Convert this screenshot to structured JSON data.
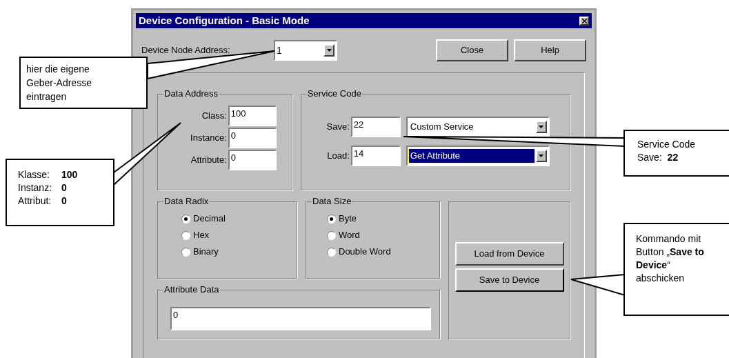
{
  "window": {
    "title": "Device Configuration - Basic Mode"
  },
  "node_address": {
    "label": "Device Node Address:",
    "value": "1"
  },
  "header_buttons": [
    {
      "label": "Close"
    },
    {
      "label": "Help"
    }
  ],
  "data_address": {
    "title": "Data Address",
    "fields": [
      {
        "label": "Class:",
        "value": "100"
      },
      {
        "label": "Instance:",
        "value": "0"
      },
      {
        "label": "Attribute:",
        "value": "0"
      }
    ]
  },
  "service_code": {
    "title": "Service Code",
    "rows": [
      {
        "label": "Save:",
        "value": "22",
        "service": "Custom Service",
        "focused": false
      },
      {
        "label": "Load:",
        "value": "14",
        "service": "Get Attribute",
        "focused": true
      }
    ]
  },
  "data_radix": {
    "title": "Data Radix",
    "options": [
      {
        "label": "Decimal",
        "selected": true
      },
      {
        "label": "Hex",
        "selected": false
      },
      {
        "label": "Binary",
        "selected": false
      }
    ]
  },
  "data_size": {
    "title": "Data Size",
    "options": [
      {
        "label": "Byte",
        "selected": true
      },
      {
        "label": "Word",
        "selected": false
      },
      {
        "label": "Double Word",
        "selected": false
      }
    ]
  },
  "device_buttons": [
    {
      "label": "Load from Device"
    },
    {
      "label": "Save to Device"
    }
  ],
  "attribute_data": {
    "title": "Attribute Data",
    "value": "0"
  },
  "callouts": {
    "node": "hier die eigene Geber-Adresse eintragen",
    "address": [
      {
        "label": "Klasse:",
        "value": "100"
      },
      {
        "label": "Instanz:",
        "value": "0"
      },
      {
        "label": "Attribut:",
        "value": "0"
      }
    ],
    "service": [
      "Service Code",
      "Save:  **22**"
    ],
    "command": "Kommando mit Button „**Save to Device**“ abschicken"
  }
}
